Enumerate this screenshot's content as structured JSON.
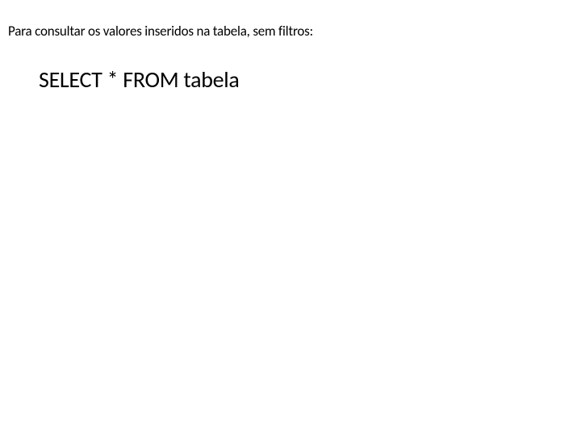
{
  "description": "Para consultar os valores inseridos na tabela, sem filtros:",
  "sql": "SELECT * FROM tabela"
}
